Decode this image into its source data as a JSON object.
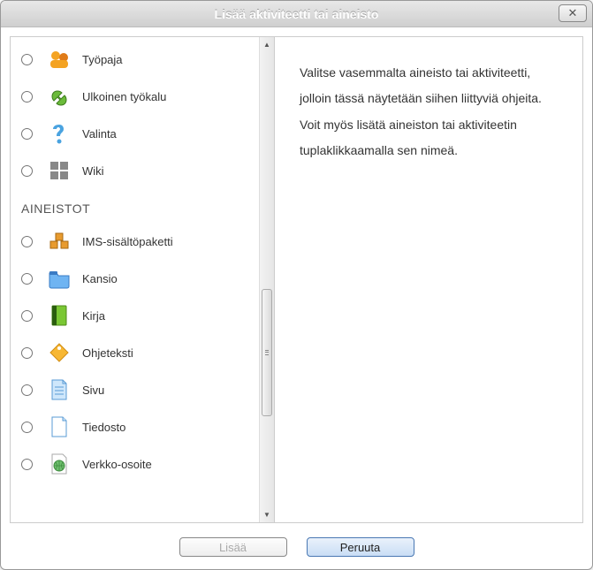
{
  "dialog": {
    "title": "Lisää aktiviteetti tai aineisto"
  },
  "activities": [
    {
      "label": "Työpaja",
      "icon": "workshop"
    },
    {
      "label": "Ulkoinen työkalu",
      "icon": "external-tool"
    },
    {
      "label": "Valinta",
      "icon": "choice"
    },
    {
      "label": "Wiki",
      "icon": "wiki"
    }
  ],
  "resources_heading": "AINEISTOT",
  "resources": [
    {
      "label": "IMS-sisältöpaketti",
      "icon": "ims"
    },
    {
      "label": "Kansio",
      "icon": "folder"
    },
    {
      "label": "Kirja",
      "icon": "book"
    },
    {
      "label": "Ohjeteksti",
      "icon": "label"
    },
    {
      "label": "Sivu",
      "icon": "page"
    },
    {
      "label": "Tiedosto",
      "icon": "file"
    },
    {
      "label": "Verkko-osoite",
      "icon": "url"
    }
  ],
  "help_text": "Valitse vasemmalta aineisto tai aktiviteetti, jolloin tässä näytetään siihen liittyviä ohjeita. Voit myös lisätä aineiston tai aktiviteetin tuplaklikkaamalla sen nimeä.",
  "buttons": {
    "add": "Lisää",
    "cancel": "Peruuta"
  }
}
